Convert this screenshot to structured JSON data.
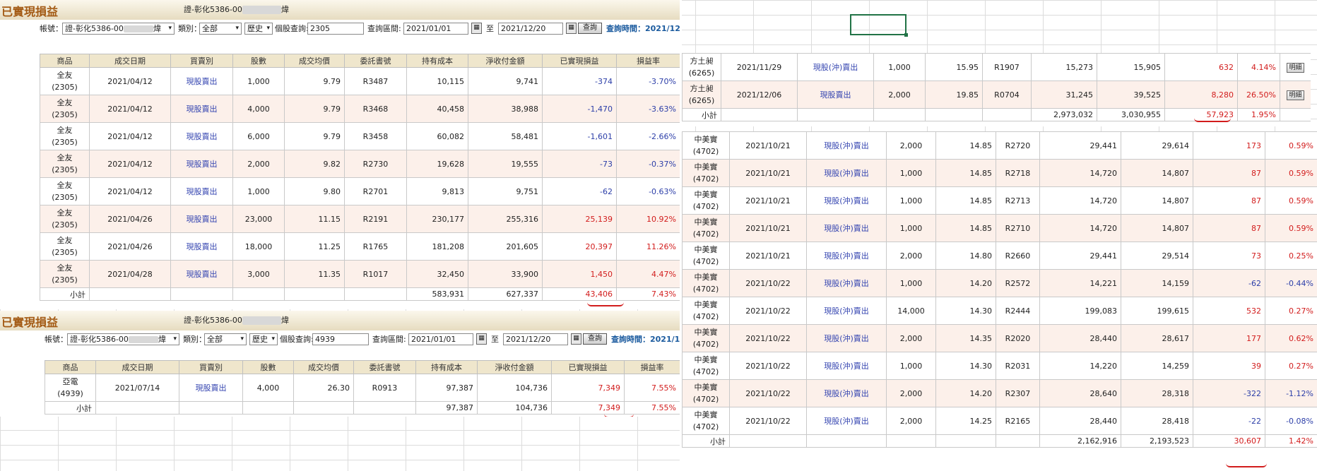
{
  "panel_title": "已實現損益",
  "account_label": "證-彰化5386-00",
  "account_suffix": "煒",
  "controls": {
    "acct_label": "帳號：",
    "acct_value": "證-彰化5386-00",
    "acct_suffix": "煒",
    "type_label": "類別：",
    "type_value": "全部",
    "history_value": "歷史",
    "stock_query_label": "個股查詢:",
    "range_label": "查詢區間:",
    "date_from": "2021/01/01",
    "to_label": "至",
    "date_to": "2021/12/20",
    "query_button": "查詢",
    "query_time_label": "查詢時間：2021/12"
  },
  "headers": [
    "商品",
    "成交日期",
    "買賣別",
    "股數",
    "成交均價",
    "委託書號",
    "持有成本",
    "淨收付金額",
    "已實現損益",
    "損益率"
  ],
  "subtotal_label": "小計",
  "detail_button": "明細",
  "panel1": {
    "stock_query": "2305",
    "rows": [
      {
        "name": "全友",
        "code": "(2305)",
        "date": "2021/04/12",
        "side": "現股賣出",
        "shares": "1,000",
        "price": "9.79",
        "order": "R3487",
        "cost": "10,115",
        "net": "9,741",
        "pl": "-374",
        "rate": "-3.70%"
      },
      {
        "name": "全友",
        "code": "(2305)",
        "date": "2021/04/12",
        "side": "現股賣出",
        "shares": "4,000",
        "price": "9.79",
        "order": "R3468",
        "cost": "40,458",
        "net": "38,988",
        "pl": "-1,470",
        "rate": "-3.63%"
      },
      {
        "name": "全友",
        "code": "(2305)",
        "date": "2021/04/12",
        "side": "現股賣出",
        "shares": "6,000",
        "price": "9.79",
        "order": "R3458",
        "cost": "60,082",
        "net": "58,481",
        "pl": "-1,601",
        "rate": "-2.66%"
      },
      {
        "name": "全友",
        "code": "(2305)",
        "date": "2021/04/12",
        "side": "現股賣出",
        "shares": "2,000",
        "price": "9.82",
        "order": "R2730",
        "cost": "19,628",
        "net": "19,555",
        "pl": "-73",
        "rate": "-0.37%"
      },
      {
        "name": "全友",
        "code": "(2305)",
        "date": "2021/04/12",
        "side": "現股賣出",
        "shares": "1,000",
        "price": "9.80",
        "order": "R2701",
        "cost": "9,813",
        "net": "9,751",
        "pl": "-62",
        "rate": "-0.63%"
      },
      {
        "name": "全友",
        "code": "(2305)",
        "date": "2021/04/26",
        "side": "現股賣出",
        "shares": "23,000",
        "price": "11.15",
        "order": "R2191",
        "cost": "230,177",
        "net": "255,316",
        "pl": "25,139",
        "rate": "10.92%"
      },
      {
        "name": "全友",
        "code": "(2305)",
        "date": "2021/04/26",
        "side": "現股賣出",
        "shares": "18,000",
        "price": "11.25",
        "order": "R1765",
        "cost": "181,208",
        "net": "201,605",
        "pl": "20,397",
        "rate": "11.26%"
      },
      {
        "name": "全友",
        "code": "(2305)",
        "date": "2021/04/28",
        "side": "現股賣出",
        "shares": "3,000",
        "price": "11.35",
        "order": "R1017",
        "cost": "32,450",
        "net": "33,900",
        "pl": "1,450",
        "rate": "4.47%"
      }
    ],
    "subtotal": {
      "cost": "583,931",
      "net": "627,337",
      "pl": "43,406",
      "rate": "7.43%"
    }
  },
  "panel2": {
    "stock_query": "4939",
    "rows": [
      {
        "name": "亞電",
        "code": "(4939)",
        "date": "2021/07/14",
        "side": "現股賣出",
        "shares": "4,000",
        "price": "26.30",
        "order": "R0913",
        "cost": "97,387",
        "net": "104,736",
        "pl": "7,349",
        "rate": "7.55%"
      }
    ],
    "subtotal": {
      "cost": "97,387",
      "net": "104,736",
      "pl": "7,349",
      "rate": "7.55%"
    }
  },
  "panel3": {
    "rows": [
      {
        "name": "方土昶",
        "code": "(6265)",
        "date": "2021/11/29",
        "side": "現股(沖)賣出",
        "shares": "1,000",
        "price": "15.95",
        "order": "R1907",
        "cost": "15,273",
        "net": "15,905",
        "pl": "632",
        "rate": "4.14%"
      },
      {
        "name": "方土昶",
        "code": "(6265)",
        "date": "2021/12/06",
        "side": "現股賣出",
        "shares": "2,000",
        "price": "19.85",
        "order": "R0704",
        "cost": "31,245",
        "net": "39,525",
        "pl": "8,280",
        "rate": "26.50%"
      }
    ],
    "subtotal": {
      "cost": "2,973,032",
      "net": "3,030,955",
      "pl": "57,923",
      "rate": "1.95%"
    }
  },
  "panel4": {
    "rows": [
      {
        "name": "中美實",
        "code": "(4702)",
        "date": "2021/10/21",
        "side": "現股(沖)賣出",
        "shares": "2,000",
        "price": "14.85",
        "order": "R2720",
        "cost": "29,441",
        "net": "29,614",
        "pl": "173",
        "rate": "0.59%"
      },
      {
        "name": "中美實",
        "code": "(4702)",
        "date": "2021/10/21",
        "side": "現股(沖)賣出",
        "shares": "1,000",
        "price": "14.85",
        "order": "R2718",
        "cost": "14,720",
        "net": "14,807",
        "pl": "87",
        "rate": "0.59%"
      },
      {
        "name": "中美實",
        "code": "(4702)",
        "date": "2021/10/21",
        "side": "現股(沖)賣出",
        "shares": "1,000",
        "price": "14.85",
        "order": "R2713",
        "cost": "14,720",
        "net": "14,807",
        "pl": "87",
        "rate": "0.59%"
      },
      {
        "name": "中美實",
        "code": "(4702)",
        "date": "2021/10/21",
        "side": "現股(沖)賣出",
        "shares": "1,000",
        "price": "14.85",
        "order": "R2710",
        "cost": "14,720",
        "net": "14,807",
        "pl": "87",
        "rate": "0.59%"
      },
      {
        "name": "中美實",
        "code": "(4702)",
        "date": "2021/10/21",
        "side": "現股(沖)賣出",
        "shares": "2,000",
        "price": "14.80",
        "order": "R2660",
        "cost": "29,441",
        "net": "29,514",
        "pl": "73",
        "rate": "0.25%"
      },
      {
        "name": "中美實",
        "code": "(4702)",
        "date": "2021/10/22",
        "side": "現股(沖)賣出",
        "shares": "1,000",
        "price": "14.20",
        "order": "R2572",
        "cost": "14,221",
        "net": "14,159",
        "pl": "-62",
        "rate": "-0.44%"
      },
      {
        "name": "中美實",
        "code": "(4702)",
        "date": "2021/10/22",
        "side": "現股(沖)賣出",
        "shares": "14,000",
        "price": "14.30",
        "order": "R2444",
        "cost": "199,083",
        "net": "199,615",
        "pl": "532",
        "rate": "0.27%"
      },
      {
        "name": "中美實",
        "code": "(4702)",
        "date": "2021/10/22",
        "side": "現股(沖)賣出",
        "shares": "2,000",
        "price": "14.35",
        "order": "R2020",
        "cost": "28,440",
        "net": "28,617",
        "pl": "177",
        "rate": "0.62%"
      },
      {
        "name": "中美實",
        "code": "(4702)",
        "date": "2021/10/22",
        "side": "現股(沖)賣出",
        "shares": "1,000",
        "price": "14.30",
        "order": "R2031",
        "cost": "14,220",
        "net": "14,259",
        "pl": "39",
        "rate": "0.27%"
      },
      {
        "name": "中美實",
        "code": "(4702)",
        "date": "2021/10/22",
        "side": "現股(沖)賣出",
        "shares": "2,000",
        "price": "14.20",
        "order": "R2307",
        "cost": "28,640",
        "net": "28,318",
        "pl": "-322",
        "rate": "-1.12%"
      },
      {
        "name": "中美實",
        "code": "(4702)",
        "date": "2021/10/22",
        "side": "現股(沖)賣出",
        "shares": "2,000",
        "price": "14.25",
        "order": "R2165",
        "cost": "28,440",
        "net": "28,418",
        "pl": "-22",
        "rate": "-0.08%"
      }
    ],
    "subtotal": {
      "cost": "2,162,916",
      "net": "2,193,523",
      "pl": "30,607",
      "rate": "1.42%"
    }
  }
}
